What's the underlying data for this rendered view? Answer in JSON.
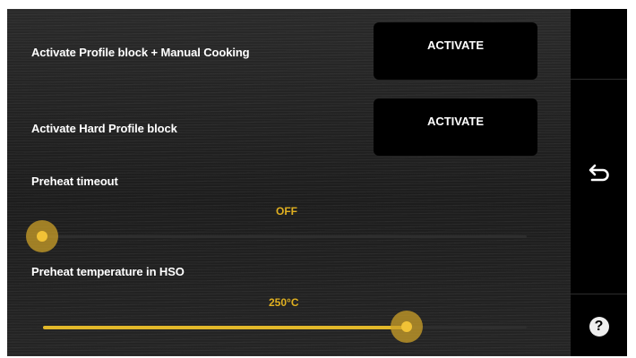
{
  "settings": {
    "profile_manual_label": "Activate Profile block + Manual Cooking",
    "profile_manual_button": "ACTIVATE",
    "hard_profile_label": "Activate Hard Profile block",
    "hard_profile_button": "ACTIVATE",
    "preheat_timeout_label": "Preheat timeout",
    "preheat_timeout_value": "OFF",
    "preheat_timeout_level": 0,
    "preheat_temp_label": "Preheat temperature in HSO",
    "preheat_temp_value": "250°C",
    "preheat_temp_level": 0.75
  },
  "sidebar": {
    "back_icon": "back-arrow-icon",
    "help_icon": "question-icon",
    "help_glyph": "?"
  },
  "colors": {
    "accent": "#e2b82a",
    "background": "#1f1f1f",
    "button": "#000000"
  }
}
